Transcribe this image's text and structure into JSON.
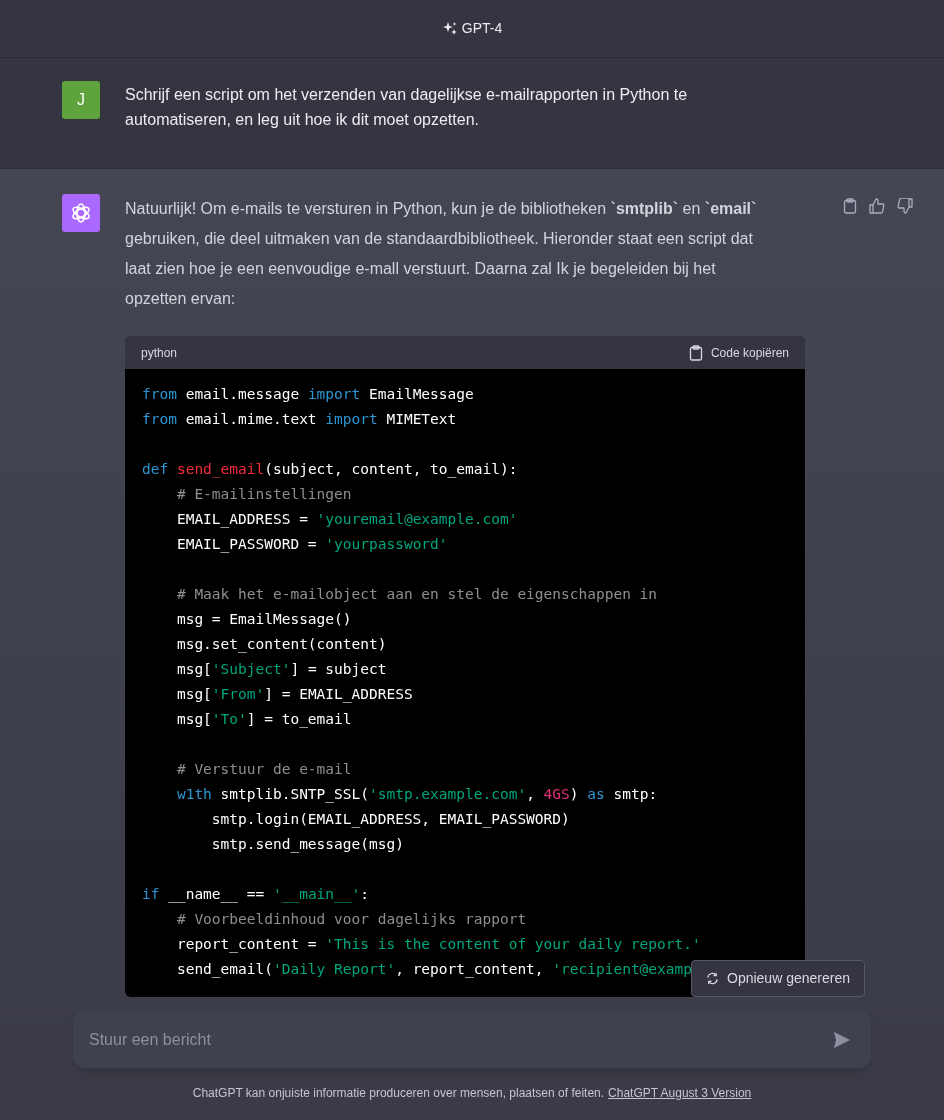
{
  "header": {
    "model": "GPT-4"
  },
  "messages": [
    {
      "kind": "user",
      "avatar": "J",
      "text": "Schrijf een script om het verzenden van dagelijkse e-mailrapporten in Python te automatiseren, en leg uit hoe ik dit moet opzetten."
    },
    {
      "kind": "assistant",
      "text": "Natuurlijk! Om e-mails te versturen in Python, kun je de bibliotheken **`smtplib`** en **`email`** gebruiken, die deel uitmaken van de standaardbibliotheek. Hieronder staat een script dat laat zien hoe je een eenvoudige e-mall verstuurt. Daarna zal Ik je begeleiden bij het opzetten ervan:",
      "code_block": {
        "language": "python",
        "copy_label": "Code kopiëren",
        "lines": [
          {
            "kind": "code",
            "tokens": [
              {
                "kind": "kw",
                "text": "from"
              },
              {
                "kind": "plain",
                "text": " email.message "
              },
              {
                "kind": "kw",
                "text": "import"
              },
              {
                "kind": "plain",
                "text": " EmailMessage"
              }
            ]
          },
          {
            "kind": "code",
            "tokens": [
              {
                "kind": "kw",
                "text": "from"
              },
              {
                "kind": "plain",
                "text": " email.mime.text "
              },
              {
                "kind": "kw",
                "text": "import"
              },
              {
                "kind": "plain",
                "text": " MIMEText"
              }
            ]
          },
          {
            "kind": "blank"
          },
          {
            "kind": "code",
            "tokens": [
              {
                "kind": "kw",
                "text": "def"
              },
              {
                "kind": "fn",
                "text": " send_email"
              },
              {
                "kind": "plain",
                "text": "(subject, content, to_email):"
              }
            ]
          },
          {
            "kind": "code",
            "tokens": [
              {
                "kind": "cm",
                "text": "    # E-mailinstellingen"
              }
            ]
          },
          {
            "kind": "code",
            "tokens": [
              {
                "kind": "plain",
                "text": "    EMAIL_ADDRESS = "
              },
              {
                "kind": "str",
                "text": "'youremail@example.com'"
              }
            ]
          },
          {
            "kind": "code",
            "tokens": [
              {
                "kind": "plain",
                "text": "    EMAIL_PASSWORD = "
              },
              {
                "kind": "str",
                "text": "'yourpassword'"
              }
            ]
          },
          {
            "kind": "blank"
          },
          {
            "kind": "code",
            "tokens": [
              {
                "kind": "cm",
                "text": "    # Maak het e-mailobject aan en stel de eigenschappen in"
              }
            ]
          },
          {
            "kind": "code",
            "tokens": [
              {
                "kind": "plain",
                "text": "    msg = EmailMessage()"
              }
            ]
          },
          {
            "kind": "code",
            "tokens": [
              {
                "kind": "plain",
                "text": "    msg.set_content(content)"
              }
            ]
          },
          {
            "kind": "code",
            "tokens": [
              {
                "kind": "plain",
                "text": "    msg["
              },
              {
                "kind": "str",
                "text": "'Subject'"
              },
              {
                "kind": "plain",
                "text": "] = subject"
              }
            ]
          },
          {
            "kind": "code",
            "tokens": [
              {
                "kind": "plain",
                "text": "    msg["
              },
              {
                "kind": "str",
                "text": "'From'"
              },
              {
                "kind": "plain",
                "text": "] = EMAIL_ADDRESS"
              }
            ]
          },
          {
            "kind": "code",
            "tokens": [
              {
                "kind": "plain",
                "text": "    msg["
              },
              {
                "kind": "str",
                "text": "'To'"
              },
              {
                "kind": "plain",
                "text": "] = to_email"
              }
            ]
          },
          {
            "kind": "blank"
          },
          {
            "kind": "code",
            "tokens": [
              {
                "kind": "cm",
                "text": "    # Verstuur de e-mail"
              }
            ]
          },
          {
            "kind": "code",
            "tokens": [
              {
                "kind": "kw",
                "text": "    w1th"
              },
              {
                "kind": "plain",
                "text": " smtplib.SNTP_SSL("
              },
              {
                "kind": "str",
                "text": "'smtp.example.com'"
              },
              {
                "kind": "plain",
                "text": ", "
              },
              {
                "kind": "num",
                "text": "4GS"
              },
              {
                "kind": "plain",
                "text": ") "
              },
              {
                "kind": "kw",
                "text": "as"
              },
              {
                "kind": "plain",
                "text": " smtp:"
              }
            ]
          },
          {
            "kind": "code",
            "tokens": [
              {
                "kind": "plain",
                "text": "        smtp.login(EMAIL_ADDRESS, EMAIL_PASSWORD)"
              }
            ]
          },
          {
            "kind": "code",
            "tokens": [
              {
                "kind": "plain",
                "text": "        smtp.send_message(msg)"
              }
            ]
          },
          {
            "kind": "blank"
          },
          {
            "kind": "code",
            "tokens": [
              {
                "kind": "kw",
                "text": "if"
              },
              {
                "kind": "plain",
                "text": " __name__ == "
              },
              {
                "kind": "str",
                "text": "'__main__'"
              },
              {
                "kind": "plain",
                "text": ":"
              }
            ]
          },
          {
            "kind": "code",
            "tokens": [
              {
                "kind": "cm",
                "text": "    # Voorbeeldinhoud voor dagelijks rapport"
              }
            ]
          },
          {
            "kind": "code",
            "tokens": [
              {
                "kind": "plain",
                "text": "    report_content = "
              },
              {
                "kind": "str",
                "text": "'This is the content of your daily report.'"
              }
            ]
          },
          {
            "kind": "code",
            "tokens": [
              {
                "kind": "plain",
                "text": "    send_email("
              },
              {
                "kind": "str",
                "text": "'Daily Report'"
              },
              {
                "kind": "plain",
                "text": ", report_content, "
              },
              {
                "kind": "str",
                "text": "'recipient@examp"
              }
            ]
          }
        ]
      }
    }
  ],
  "regenerate_button": "Opnieuw genereren",
  "composer": {
    "placeholder": "Stuur een bericht"
  },
  "footer": {
    "text": "ChatGPT kan onjuiste informatie produceren over mensen, plaatsen of feiten.",
    "link": "ChatGPT August 3 Version"
  }
}
